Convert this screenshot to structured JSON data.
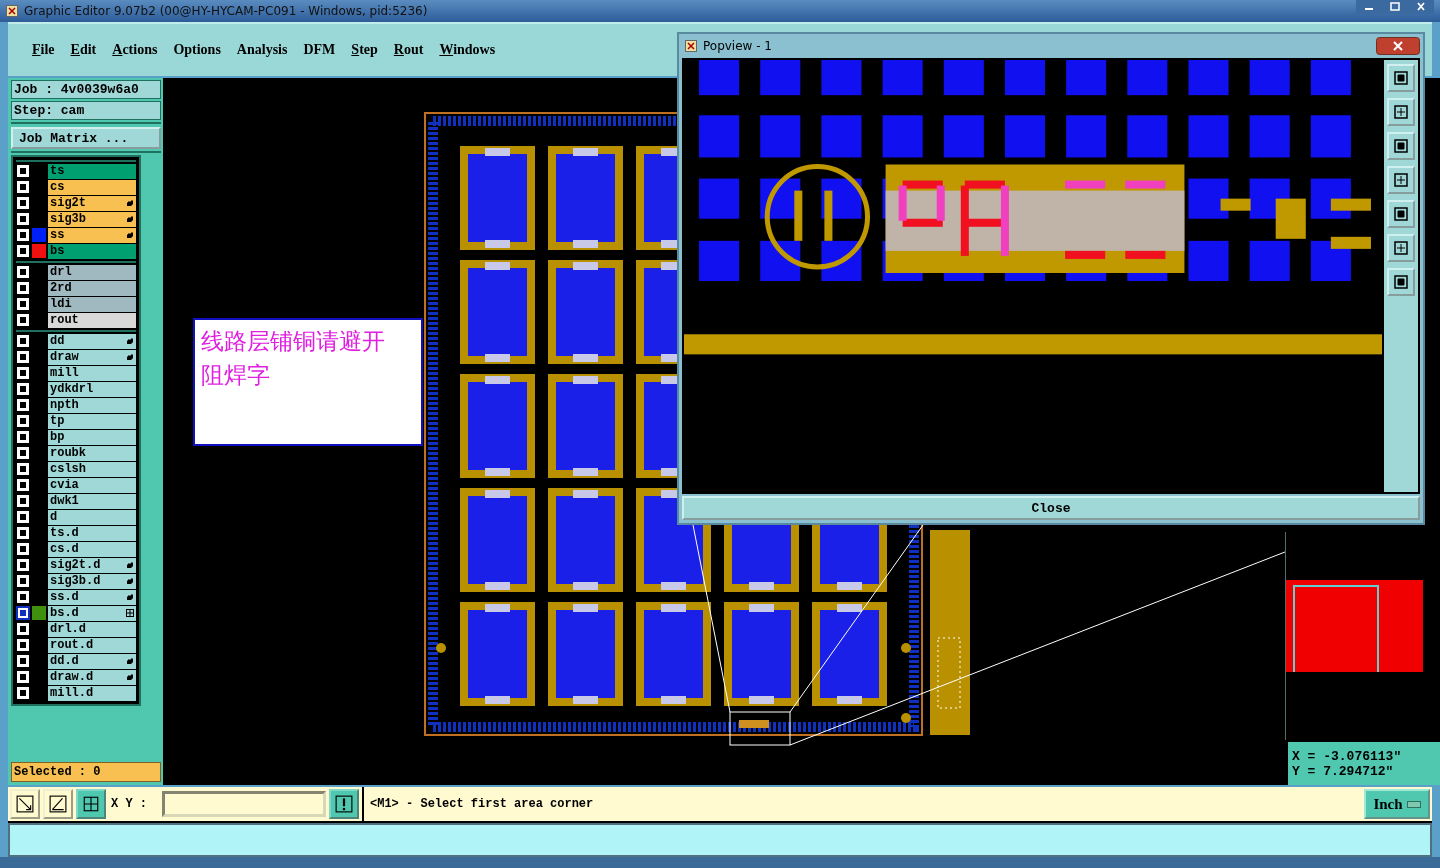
{
  "window": {
    "title": "Graphic Editor 9.07b2 (00@HY-HYCAM-PC091 - Windows, pid:5236)"
  },
  "menu": [
    {
      "label": "File",
      "underlined": true
    },
    {
      "label": "Edit",
      "underlined": true
    },
    {
      "label": "Actions",
      "underlined": true
    },
    {
      "label": "Options",
      "underlined": false
    },
    {
      "label": "Analysis",
      "underlined": false
    },
    {
      "label": "DFM",
      "underlined": false
    },
    {
      "label": "Step",
      "underlined": true
    },
    {
      "label": "Rout",
      "underlined": true
    },
    {
      "label": "Windows",
      "underlined": true
    }
  ],
  "job": {
    "job": "Job : 4v0039w6a0",
    "step": "Step: cam",
    "matrix_button": "Job Matrix ..."
  },
  "layer_groups": [
    [
      {
        "name": "ts",
        "color": "#00a070",
        "kind": "plain",
        "selected": false
      },
      {
        "name": "cs",
        "color": "#f8c050",
        "kind": "plain",
        "selected": false
      },
      {
        "name": "sig2t",
        "color": "#f8c050",
        "kind": "hand",
        "selected": false
      },
      {
        "name": "sig3b",
        "color": "#f8c050",
        "kind": "hand",
        "selected": false
      },
      {
        "name": "ss",
        "color": "#f8c050",
        "swatch": {
          "color": "#0020f8"
        },
        "kind": "hand",
        "selected": false
      },
      {
        "name": "bs",
        "color": "#00a070",
        "swatch": {
          "color": "#f01010"
        },
        "kind": "plain",
        "selected": false
      }
    ],
    [
      {
        "name": "drl",
        "color": "#a0b8c0",
        "kind": "plain",
        "selected": false
      },
      {
        "name": "2rd",
        "color": "#a0b8c0",
        "kind": "plain",
        "selected": false
      },
      {
        "name": "ldi",
        "color": "#a0b8c0",
        "kind": "plain",
        "selected": false
      },
      {
        "name": "rout",
        "color": "#d8d8d8",
        "kind": "plain",
        "selected": false
      }
    ],
    [
      {
        "name": "dd",
        "color": "#a0d8d8",
        "kind": "hand",
        "selected": false
      },
      {
        "name": "draw",
        "color": "#a0d8d8",
        "kind": "hand",
        "selected": false
      },
      {
        "name": "mill",
        "color": "#a0d8d8",
        "kind": "plain",
        "selected": false
      },
      {
        "name": "ydkdrl",
        "color": "#a0d8d8",
        "kind": "plain",
        "selected": false
      },
      {
        "name": "npth",
        "color": "#a0d8d8",
        "kind": "plain",
        "selected": false
      },
      {
        "name": "tp",
        "color": "#a0d8d8",
        "kind": "plain",
        "selected": false
      },
      {
        "name": "bp",
        "color": "#a0d8d8",
        "kind": "plain",
        "selected": false
      },
      {
        "name": "roubk",
        "color": "#a0d8d8",
        "kind": "plain",
        "selected": false
      },
      {
        "name": "cslsh",
        "color": "#a0d8d8",
        "kind": "plain",
        "selected": false
      },
      {
        "name": "cvia",
        "color": "#a0d8d8",
        "kind": "plain",
        "selected": false
      },
      {
        "name": "dwk1",
        "color": "#a0d8d8",
        "kind": "plain",
        "selected": false
      },
      {
        "name": "d",
        "color": "#a0d8d8",
        "kind": "plain",
        "selected": false
      },
      {
        "name": "ts.d",
        "color": "#a0d8d8",
        "kind": "plain",
        "selected": false
      },
      {
        "name": "cs.d",
        "color": "#a0d8d8",
        "kind": "plain",
        "selected": false
      },
      {
        "name": "sig2t.d",
        "color": "#a0d8d8",
        "kind": "hand",
        "selected": false
      },
      {
        "name": "sig3b.d",
        "color": "#a0d8d8",
        "kind": "hand",
        "selected": false
      },
      {
        "name": "ss.d",
        "color": "#a0d8d8",
        "kind": "hand",
        "selected": false
      },
      {
        "name": "bs.d",
        "color": "#a0d8d8",
        "swatch": {
          "color": "#409010"
        },
        "kind": "grid",
        "selected": true
      },
      {
        "name": "drl.d",
        "color": "#a0d8d8",
        "kind": "plain",
        "selected": false
      },
      {
        "name": "rout.d",
        "color": "#a0d8d8",
        "kind": "plain",
        "selected": false
      },
      {
        "name": "dd.d",
        "color": "#a0d8d8",
        "kind": "hand",
        "selected": false
      },
      {
        "name": "draw.d",
        "color": "#a0d8d8",
        "kind": "hand",
        "selected": false
      },
      {
        "name": "mill.d",
        "color": "#a0d8d8",
        "kind": "plain",
        "selected": false
      }
    ]
  ],
  "selected_count": "Selected : 0",
  "annotation": "线路层铺铜请避开阻焊字",
  "popview": {
    "title": "Popview - 1",
    "close_button": "Close"
  },
  "coordinates": {
    "x": "X = -3.076113\"",
    "y": "Y = 7.294712\""
  },
  "command_bar": {
    "xy_label": "X Y :",
    "message": "<M1> - Select first area corner",
    "units": "Inch"
  }
}
